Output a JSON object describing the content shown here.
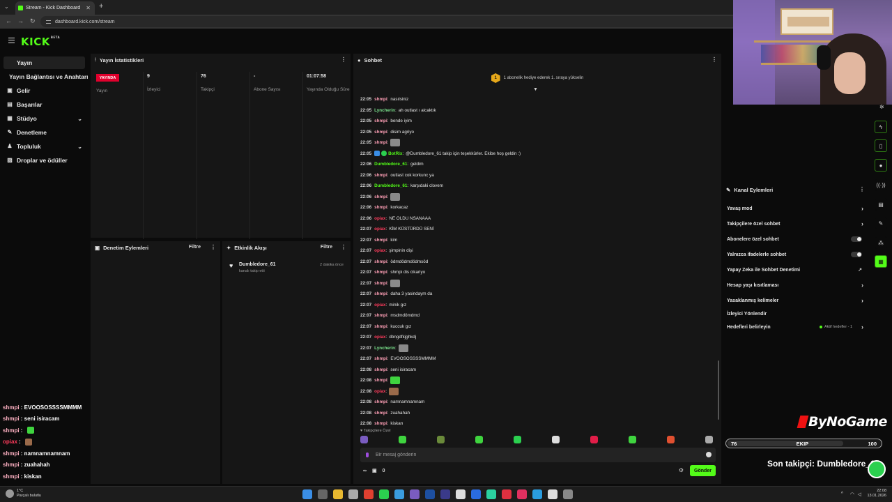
{
  "browser": {
    "tab_title": "Stream - Kick Dashboard",
    "url": "dashboard.kick.com/stream"
  },
  "header": {
    "logo": "KICK",
    "logo_beta": "BETA"
  },
  "sidebar": {
    "items": [
      {
        "label": "Yayın",
        "icon": "broadcast-icon"
      },
      {
        "label": "Yayın Bağlantısı ve Anahtarı",
        "icon": "link-icon"
      },
      {
        "label": "Gelir",
        "icon": "money-icon"
      },
      {
        "label": "Başarılar",
        "icon": "trophy-icon"
      },
      {
        "label": "Stüdyo",
        "icon": "studio-icon"
      },
      {
        "label": "Denetleme",
        "icon": "wrench-icon"
      },
      {
        "label": "Topluluk",
        "icon": "community-icon"
      },
      {
        "label": "Droplar ve ödüller",
        "icon": "gift-icon"
      }
    ]
  },
  "stats": {
    "title": "Yayın İstatistikleri",
    "live_badge": "YAYINDA",
    "live_label": "Yayın",
    "items": [
      {
        "value": "9",
        "label": "İzleyici"
      },
      {
        "value": "76",
        "label": "Takipçi"
      },
      {
        "value": "-",
        "label": "Abone Sayısı"
      },
      {
        "value": "01:07:58",
        "label": "Yayında Olduğu Süre"
      }
    ]
  },
  "moderation": {
    "title": "Denetim Eylemleri",
    "filter": "Filtre"
  },
  "activity": {
    "title": "Etkinlik Akışı",
    "filter": "Filtre",
    "events": [
      {
        "user": "Dumbledore_61",
        "desc": "kanalı takip etti",
        "time": "2 dakika önce"
      }
    ]
  },
  "chat": {
    "title": "Sohbet",
    "sub_goal_number": "1",
    "sub_goal_text": "1 abonelik hediye ederek 1. sıraya yükselin",
    "messages": [
      {
        "time": "22:05",
        "user": "shmpi",
        "color": "#ff9fb6",
        "text": "nasılsiniz"
      },
      {
        "time": "22:05",
        "user": "Lyncherin",
        "color": "#7be38d",
        "text": "ah outlast ı alcaktık"
      },
      {
        "time": "22:05",
        "user": "shmpi",
        "color": "#ff9fb6",
        "text": "bende iyim"
      },
      {
        "time": "22:05",
        "user": "shmpi",
        "color": "#ff9fb6",
        "text": "disim agriyo"
      },
      {
        "time": "22:05",
        "user": "shmpi",
        "color": "#ff9fb6",
        "text": "",
        "emote": "#8a8a8a"
      },
      {
        "time": "22:05",
        "user": "BotRix",
        "color": "#53fc18",
        "text": "@Dumbledore_61 takip için teşekkürler. Ekibe hoş geldin :)",
        "bot": true
      },
      {
        "time": "22:06",
        "user": "Dumbledore_61",
        "color": "#53fc18",
        "text": "geldim"
      },
      {
        "time": "22:06",
        "user": "shmpi",
        "color": "#ff9fb6",
        "text": "outlast cok korkunc ya"
      },
      {
        "time": "22:06",
        "user": "Dumbledore_61",
        "color": "#53fc18",
        "text": "karşıdaki clovem"
      },
      {
        "time": "22:06",
        "user": "shmpi",
        "color": "#ff9fb6",
        "text": "",
        "emote": "#8a8a8a"
      },
      {
        "time": "22:06",
        "user": "shmpi",
        "color": "#ff9fb6",
        "text": "korkacaz"
      },
      {
        "time": "22:06",
        "user": "opiax",
        "color": "#ff3b5c",
        "text": "NE OLDU NSANAAA"
      },
      {
        "time": "22:07",
        "user": "opiax",
        "color": "#ff3b5c",
        "text": "KİM KÜSTÜRDÜ SENİ"
      },
      {
        "time": "22:07",
        "user": "shmpi",
        "color": "#ff9fb6",
        "text": "kim"
      },
      {
        "time": "22:07",
        "user": "opiax",
        "color": "#ff3b5c",
        "text": "şimpinin dişi"
      },
      {
        "time": "22:07",
        "user": "shmpi",
        "color": "#ff9fb6",
        "text": "ödmdödmdödmsöd"
      },
      {
        "time": "22:07",
        "user": "shmpi",
        "color": "#ff9fb6",
        "text": "shmpi dis cikariyo"
      },
      {
        "time": "22:07",
        "user": "shmpi",
        "color": "#ff9fb6",
        "text": "",
        "emote": "#8a8a8a"
      },
      {
        "time": "22:07",
        "user": "shmpi",
        "color": "#ff9fb6",
        "text": "daha 3 yasindaym da"
      },
      {
        "time": "22:07",
        "user": "opiax",
        "color": "#ff3b5c",
        "text": "minik gız"
      },
      {
        "time": "22:07",
        "user": "shmpi",
        "color": "#ff9fb6",
        "text": "msdmdömdmd"
      },
      {
        "time": "22:07",
        "user": "shmpi",
        "color": "#ff9fb6",
        "text": "kuccuk gız"
      },
      {
        "time": "22:07",
        "user": "opiax",
        "color": "#ff3b5c",
        "text": "dbngdfkjghkdj"
      },
      {
        "time": "22:07",
        "user": "Lyncherin",
        "color": "#7be38d",
        "text": "",
        "emote": "#8a8a8a"
      },
      {
        "time": "22:07",
        "user": "shmpi",
        "color": "#ff9fb6",
        "text": "EVOOSOSSSSMMMM"
      },
      {
        "time": "22:08",
        "user": "shmpi",
        "color": "#ff9fb6",
        "text": "seni isiracam"
      },
      {
        "time": "22:08",
        "user": "shmpi",
        "color": "#ff9fb6",
        "text": "",
        "emote": "#3fd43f"
      },
      {
        "time": "22:08",
        "user": "opiax",
        "color": "#ff3b5c",
        "text": "",
        "emote": "#9a6a4a"
      },
      {
        "time": "22:08",
        "user": "shmpi",
        "color": "#ff9fb6",
        "text": "namnamnamnam"
      },
      {
        "time": "22:08",
        "user": "shmpi",
        "color": "#ff9fb6",
        "text": "zuahahah"
      },
      {
        "time": "22:08",
        "user": "shmpi",
        "color": "#ff9fb6",
        "text": "kiskan"
      }
    ],
    "follow_only_label": "Takipçilere Özel",
    "input_placeholder": "Bir mesaj gönderin",
    "points": "0",
    "send_label": "Gönder",
    "emote_colors": [
      "#7a5cc0",
      "#3fd43f",
      "#6a8a3a",
      "#3fd43f",
      "#2bd04f",
      "#dddddd",
      "#e11d48",
      "#3fd43f",
      "#e05030",
      "#aaaaaa"
    ]
  },
  "channel_actions": {
    "title": "Kanal Eylemleri",
    "items": [
      {
        "label": "Yavaş mod",
        "kind": "chevron"
      },
      {
        "label": "Takipçilere özel sohbet",
        "kind": "chevron"
      },
      {
        "label": "Abonelere özel sohbet",
        "kind": "toggle"
      },
      {
        "label": "Yalnızca ifadelerle sohbet",
        "kind": "toggle"
      },
      {
        "label": "Yapay Zeka ile Sohbet Denetimi",
        "kind": "external"
      },
      {
        "label": "Hesap yaşı kısıtlaması",
        "kind": "chevron"
      },
      {
        "label": "Yasaklanmış kelimeler",
        "kind": "chevron"
      },
      {
        "label": "İzleyici Yönlendir",
        "kind": "none"
      },
      {
        "label": "Hedefleri belirleyin",
        "kind": "goals",
        "extra": "Aktif hedefler - 1"
      }
    ]
  },
  "overlay": {
    "chat": [
      {
        "user": "shmpi",
        "text": "EVOOSOSSSSMMMM",
        "red": false
      },
      {
        "user": "shmpi",
        "text": "seni isiracam",
        "red": false
      },
      {
        "user": "shmpi",
        "text": "",
        "red": false,
        "emote": "#3fd43f"
      },
      {
        "user": "opiax",
        "text": "",
        "red": true,
        "emote": "#9a6a4a"
      },
      {
        "user": "shmpi",
        "text": "namnamnamnam",
        "red": false
      },
      {
        "user": "shmpi",
        "text": "zuahahah",
        "red": false
      },
      {
        "user": "shmpi",
        "text": "kiskan",
        "red": false
      }
    ],
    "brand": "ByNoGame",
    "ekip_current": "76",
    "ekip_label": "EKIP",
    "ekip_target": "100",
    "ekip_progress": 0.76,
    "last_follower": "Son takipçi: Dumbledore_61"
  },
  "taskbar": {
    "weather_temp": "1°C",
    "weather_desc": "Parçalı bulutlu",
    "time": "22:08",
    "date": "13.01.2026",
    "app_colors": [
      "#3a8ee6",
      "#666666",
      "#e8b830",
      "#aaaaaa",
      "#e04030",
      "#2bd04f",
      "#3a9de0",
      "#7a5cc0",
      "#1d4fa0",
      "#3a3a8a",
      "#dddddd",
      "#2a6be0",
      "#2bd0a0",
      "#e03040",
      "#e03060",
      "#2a9de0",
      "#dddddd",
      "#888888"
    ]
  }
}
